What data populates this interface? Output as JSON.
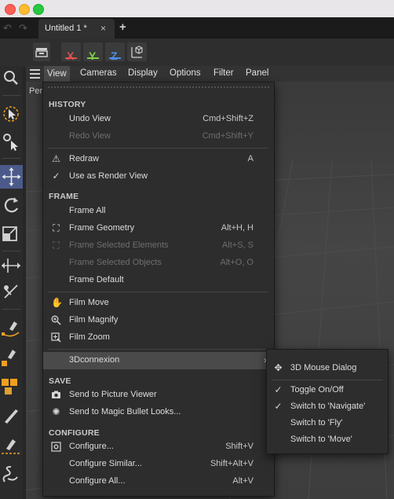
{
  "window": {
    "tab_title": "Untitled 1 *",
    "tab_close": "×",
    "tab_add": "+"
  },
  "toolbar": {
    "x_label": "X",
    "y_label": "Y",
    "z_label": "Z",
    "colors": {
      "x": "#e05050",
      "y": "#7ccf4a",
      "z": "#4d8ee8"
    }
  },
  "viewport_menu": [
    "View",
    "Cameras",
    "Display",
    "Options",
    "Filter",
    "Panel"
  ],
  "viewport_label": "Pers",
  "view_menu": {
    "history_header": "HISTORY",
    "undo_view": {
      "label": "Undo View",
      "shortcut": "Cmd+Shift+Z"
    },
    "redo_view": {
      "label": "Redo View",
      "shortcut": "Cmd+Shift+Y"
    },
    "redraw": {
      "label": "Redraw",
      "shortcut": "A",
      "icon": "warning-triangle-icon"
    },
    "use_as_render_view": {
      "label": "Use as Render View",
      "icon": "checkmark-icon"
    },
    "frame_header": "FRAME",
    "frame_all": {
      "label": "Frame All"
    },
    "frame_geometry": {
      "label": "Frame Geometry",
      "shortcut": "Alt+H, H"
    },
    "frame_selected_elements": {
      "label": "Frame Selected Elements",
      "shortcut": "Alt+S, S"
    },
    "frame_selected_objects": {
      "label": "Frame Selected Objects",
      "shortcut": "Alt+O, O"
    },
    "frame_default": {
      "label": "Frame Default"
    },
    "film_move": {
      "label": "Film Move",
      "icon": "hand-icon"
    },
    "film_magnify": {
      "label": "Film Magnify",
      "icon": "magnify-icon"
    },
    "film_zoom": {
      "label": "Film Zoom",
      "icon": "zoom-box-icon"
    },
    "three_d_connexion": {
      "label": "3Dconnexion",
      "arrow": "›"
    },
    "save_header": "SAVE",
    "send_to_picture_viewer": {
      "label": "Send to Picture Viewer",
      "icon": "camera-icon"
    },
    "send_to_magic_bullet": {
      "label": "Send to Magic Bullet Looks...",
      "icon": "gear-cluster-icon"
    },
    "configure_header": "CONFIGURE",
    "configure": {
      "label": "Configure...",
      "shortcut": "Shift+V",
      "icon": "settings-icon"
    },
    "configure_similar": {
      "label": "Configure Similar...",
      "shortcut": "Shift+Alt+V"
    },
    "configure_all": {
      "label": "Configure All...",
      "shortcut": "Alt+V"
    }
  },
  "submenu_3dconnexion": {
    "mouse_dialog": {
      "label": "3D Mouse Dialog",
      "icon": "move-arrows-icon"
    },
    "toggle_on_off": {
      "label": "Toggle On/Off",
      "checked": true
    },
    "switch_navigate": {
      "label": "Switch to 'Navigate'",
      "checked": true
    },
    "switch_fly": {
      "label": "Switch to 'Fly'"
    },
    "switch_move": {
      "label": "Switch to 'Move'"
    }
  }
}
